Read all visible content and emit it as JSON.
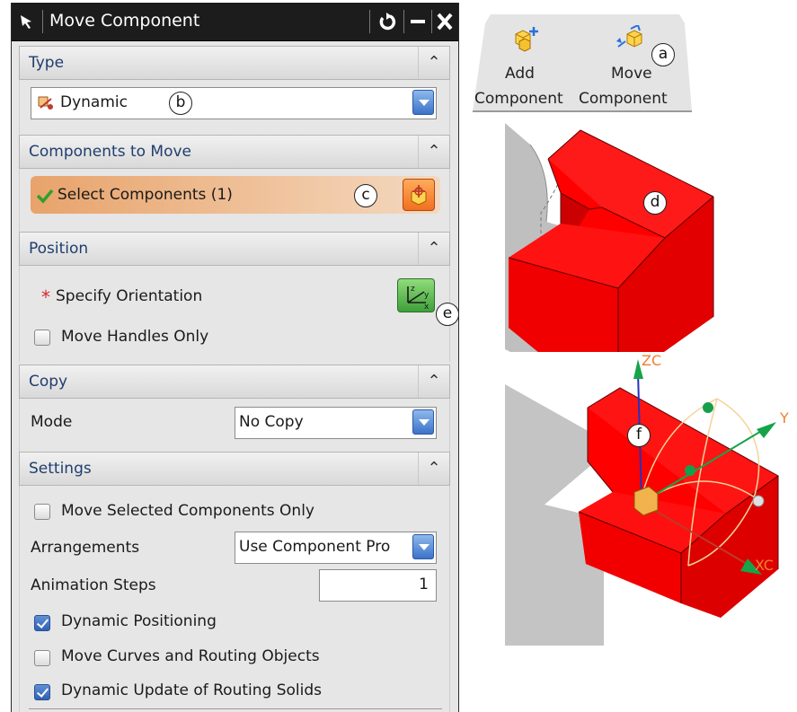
{
  "dialog": {
    "title": "Move Component",
    "title_buttons": [
      "reset-icon",
      "minimize-icon",
      "close-icon"
    ],
    "sections": {
      "type": {
        "header": "Type",
        "selected": "Dynamic"
      },
      "components_to_move": {
        "header": "Components to Move",
        "selection_label": "Select Components (1)"
      },
      "position": {
        "header": "Position",
        "orientation_label": "Specify Orientation",
        "required_marker": "*",
        "move_handles_only": {
          "label": "Move Handles Only",
          "checked": false
        }
      },
      "copy": {
        "header": "Copy",
        "mode_label": "Mode",
        "mode_value": "No Copy"
      },
      "settings": {
        "header": "Settings",
        "move_selected_only": {
          "label": "Move Selected Components Only",
          "checked": false
        },
        "arrangements_label": "Arrangements",
        "arrangements_value": "Use Component Pro",
        "animation_steps_label": "Animation Steps",
        "animation_steps_value": "1",
        "dynamic_positioning": {
          "label": "Dynamic Positioning",
          "checked": true
        },
        "move_curves": {
          "label": "Move Curves and Routing Objects",
          "checked": false
        },
        "dynamic_update": {
          "label": "Dynamic Update of Routing Solids",
          "checked": true
        }
      }
    }
  },
  "ribbon": {
    "add_component": {
      "line1": "Add",
      "line2": "Component"
    },
    "move_component": {
      "line1": "Move",
      "line2": "Component"
    }
  },
  "callouts": {
    "a": "a",
    "b": "b",
    "c": "c",
    "d": "d",
    "e": "e",
    "f": "f"
  },
  "axes": {
    "zc": "ZC",
    "xc": "XC",
    "yc": "Y"
  },
  "colors": {
    "part_red": "#ff0000",
    "accent_blue": "#3b73c9",
    "selection_orange": "#e8a36b"
  }
}
